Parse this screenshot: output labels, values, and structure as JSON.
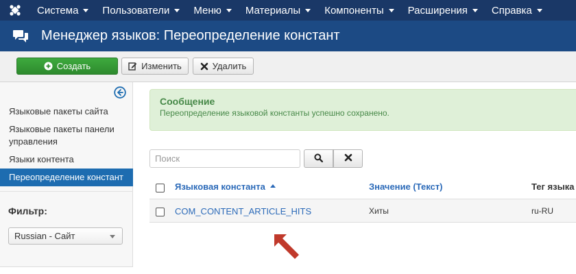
{
  "navbar": {
    "items": [
      {
        "label": "Система"
      },
      {
        "label": "Пользователи"
      },
      {
        "label": "Меню"
      },
      {
        "label": "Материалы"
      },
      {
        "label": "Компоненты"
      },
      {
        "label": "Расширения"
      },
      {
        "label": "Справка"
      }
    ]
  },
  "header": {
    "title": "Менеджер языков: Переопределение констант"
  },
  "toolbar": {
    "create_label": "Создать",
    "edit_label": "Изменить",
    "delete_label": "Удалить"
  },
  "sidebar": {
    "items": [
      {
        "label": "Языковые пакеты сайта",
        "active": false
      },
      {
        "label": "Языковые пакеты панели управления",
        "active": false
      },
      {
        "label": "Языки контента",
        "active": false
      },
      {
        "label": "Переопределение констант",
        "active": true
      }
    ],
    "filter_label": "Фильтр:",
    "filter_value": "Russian - Сайт"
  },
  "message": {
    "heading": "Сообщение",
    "text": "Переопределение языковой константы успешно сохранено."
  },
  "search": {
    "placeholder": "Поиск"
  },
  "table": {
    "columns": [
      "Языковая константа",
      "Значение (Текст)",
      "Тег языка"
    ],
    "rows": [
      {
        "constant": "COM_CONTENT_ARTICLE_HITS",
        "value": "Хиты",
        "tag": "ru-RU"
      }
    ]
  },
  "colors": {
    "navbar_bg": "#1a3867",
    "header_bg": "#1c4a84",
    "create_button": "#3eaa3e",
    "active_sidebar": "#1d6cb0",
    "message_bg": "#dff0d8",
    "message_text": "#468847",
    "link": "#2a69b8",
    "annotation_arrow": "#c0392b"
  }
}
